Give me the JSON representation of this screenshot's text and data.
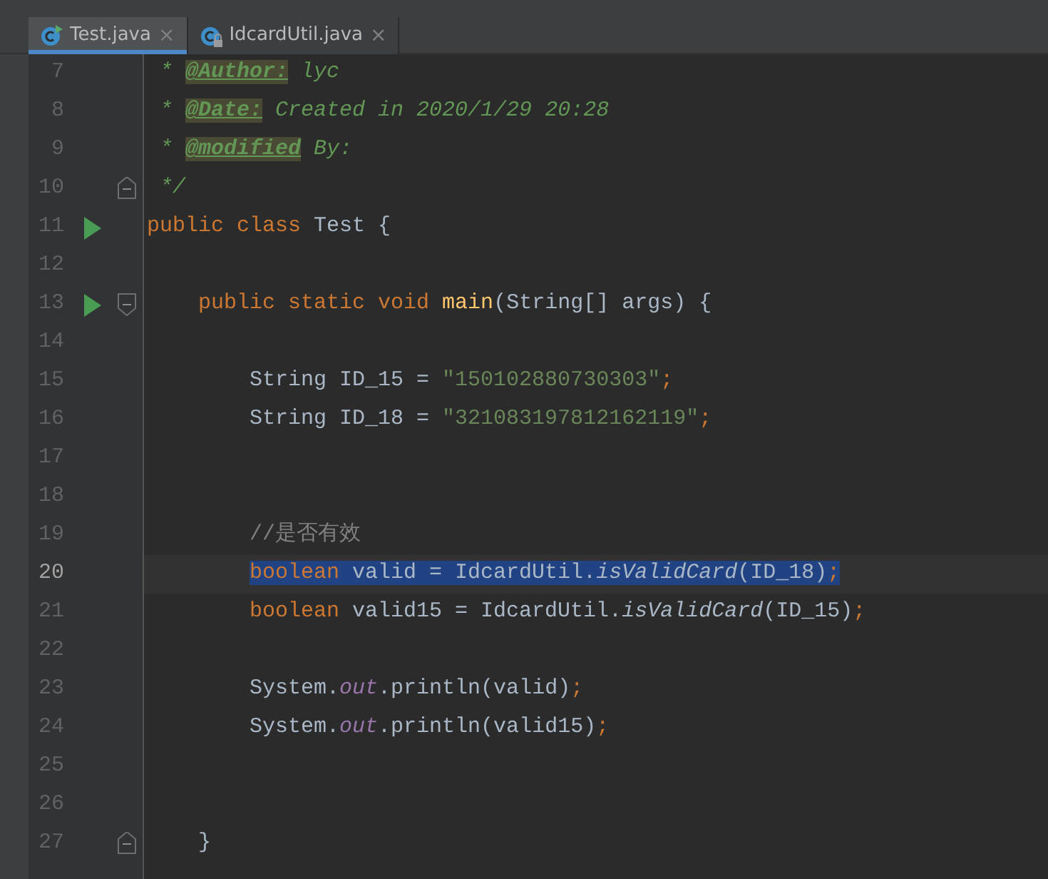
{
  "tabs": [
    {
      "label": "Test.java",
      "selected": true,
      "close": "×"
    },
    {
      "label": "IdcardUtil.java",
      "selected": false,
      "close": "×"
    }
  ],
  "lines": [
    {
      "number": "7",
      "run": false,
      "fold_start": false,
      "fold_end": false,
      "selected": false,
      "current": false,
      "tokens": [
        {
          "kind": "doc",
          "text": " * "
        },
        {
          "kind": "tag",
          "text": "@Author:"
        },
        {
          "kind": "doc",
          "text": " lyc"
        }
      ]
    },
    {
      "number": "8",
      "run": false,
      "fold_start": false,
      "fold_end": false,
      "selected": false,
      "current": false,
      "tokens": [
        {
          "kind": "doc",
          "text": " * "
        },
        {
          "kind": "tag",
          "text": "@Date:"
        },
        {
          "kind": "doc",
          "text": " Created in 2020/1/29 20:28"
        }
      ]
    },
    {
      "number": "9",
      "run": false,
      "fold_start": false,
      "fold_end": false,
      "selected": false,
      "current": false,
      "tokens": [
        {
          "kind": "doc",
          "text": " * "
        },
        {
          "kind": "tag",
          "text": "@modified"
        },
        {
          "kind": "doc",
          "text": " By:"
        }
      ]
    },
    {
      "number": "10",
      "run": false,
      "fold_start": false,
      "fold_end": true,
      "selected": false,
      "current": false,
      "tokens": [
        {
          "kind": "doc",
          "text": " */"
        }
      ]
    },
    {
      "number": "11",
      "run": true,
      "fold_start": false,
      "fold_end": false,
      "selected": false,
      "current": false,
      "tokens": [
        {
          "kind": "keyword",
          "text": "public class "
        },
        {
          "kind": "plain",
          "text": "Test {"
        }
      ]
    },
    {
      "number": "12",
      "run": false,
      "fold_start": false,
      "fold_end": false,
      "selected": false,
      "current": false
    },
    {
      "number": "13",
      "run": true,
      "fold_start": true,
      "fold_end": false,
      "selected": false,
      "current": false,
      "tokens": [
        {
          "kind": "keyword",
          "text": "    public static void "
        },
        {
          "kind": "method",
          "text": "main"
        },
        {
          "kind": "plain",
          "text": "(String[] args) {"
        }
      ]
    },
    {
      "number": "14",
      "run": false,
      "fold_start": false,
      "fold_end": false,
      "selected": false,
      "current": false
    },
    {
      "number": "15",
      "run": false,
      "fold_start": false,
      "fold_end": false,
      "selected": false,
      "current": false,
      "tokens": [
        {
          "kind": "plain",
          "text": "        String ID_15 = "
        },
        {
          "kind": "string",
          "text": "\"150102880730303\""
        },
        {
          "kind": "keyword",
          "text": ";"
        }
      ]
    },
    {
      "number": "16",
      "run": false,
      "fold_start": false,
      "fold_end": false,
      "selected": false,
      "current": false,
      "tokens": [
        {
          "kind": "plain",
          "text": "        String ID_18 = "
        },
        {
          "kind": "string",
          "text": "\"321083197812162119\""
        },
        {
          "kind": "keyword",
          "text": ";"
        }
      ]
    },
    {
      "number": "17",
      "run": false,
      "fold_start": false,
      "fold_end": false,
      "selected": false,
      "current": false
    },
    {
      "number": "18",
      "run": false,
      "fold_start": false,
      "fold_end": false,
      "selected": false,
      "current": false
    },
    {
      "number": "19",
      "run": false,
      "fold_start": false,
      "fold_end": false,
      "selected": false,
      "current": false,
      "tokens": [
        {
          "kind": "comment",
          "text": "        //是否有效"
        }
      ]
    },
    {
      "number": "20",
      "run": false,
      "fold_start": false,
      "fold_end": false,
      "selected": true,
      "current": true,
      "tokens": [
        {
          "kind": "keyword",
          "text": "boolean "
        },
        {
          "kind": "plain",
          "text": "valid = IdcardUtil."
        },
        {
          "kind": "static",
          "text": "isValidCard"
        },
        {
          "kind": "plain",
          "text": "(ID_18)"
        },
        {
          "kind": "keyword",
          "text": ";"
        }
      ]
    },
    {
      "number": "21",
      "run": false,
      "fold_start": false,
      "fold_end": false,
      "selected": false,
      "current": false,
      "tokens": [
        {
          "kind": "keyword",
          "text": "        boolean "
        },
        {
          "kind": "plain",
          "text": "valid15 = IdcardUtil."
        },
        {
          "kind": "static",
          "text": "isValidCard"
        },
        {
          "kind": "plain",
          "text": "(ID_15)"
        },
        {
          "kind": "keyword",
          "text": ";"
        }
      ]
    },
    {
      "number": "22",
      "run": false,
      "fold_start": false,
      "fold_end": false,
      "selected": false,
      "current": false
    },
    {
      "number": "23",
      "run": false,
      "fold_start": false,
      "fold_end": false,
      "selected": false,
      "current": false,
      "tokens": [
        {
          "kind": "plain",
          "text": "        System."
        },
        {
          "kind": "field",
          "text": "out"
        },
        {
          "kind": "plain",
          "text": ".println(valid)"
        },
        {
          "kind": "keyword",
          "text": ";"
        }
      ]
    },
    {
      "number": "24",
      "run": false,
      "fold_start": false,
      "fold_end": false,
      "selected": false,
      "current": false,
      "tokens": [
        {
          "kind": "plain",
          "text": "        System."
        },
        {
          "kind": "field",
          "text": "out"
        },
        {
          "kind": "plain",
          "text": ".println(valid15)"
        },
        {
          "kind": "keyword",
          "text": ";"
        }
      ]
    },
    {
      "number": "25",
      "run": false,
      "fold_start": false,
      "fold_end": false,
      "selected": false,
      "current": false
    },
    {
      "number": "26",
      "run": false,
      "fold_start": false,
      "fold_end": false,
      "selected": false,
      "current": false
    },
    {
      "number": "27",
      "run": false,
      "fold_start": false,
      "fold_end": true,
      "selected": false,
      "current": false,
      "tokens": [
        {
          "kind": "plain",
          "text": "    }"
        }
      ]
    }
  ]
}
